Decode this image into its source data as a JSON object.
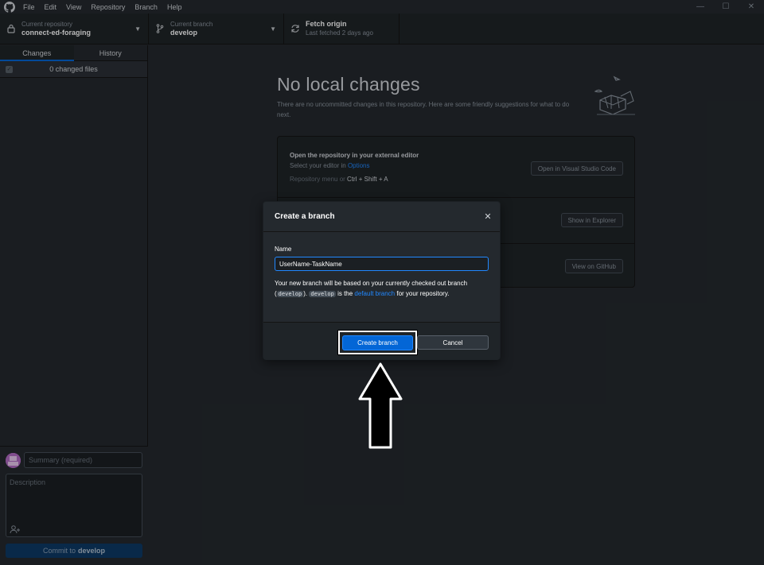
{
  "menu": [
    "File",
    "Edit",
    "View",
    "Repository",
    "Branch",
    "Help"
  ],
  "window_controls": {
    "minimize": "—",
    "maximize": "☐",
    "close": "✕"
  },
  "toolbar": {
    "repo_sub": "Current repository",
    "repo_name": "connect-ed-foraging",
    "branch_sub": "Current branch",
    "branch_name": "develop",
    "fetch_title": "Fetch origin",
    "fetch_sub": "Last fetched 2 days ago"
  },
  "sidebar": {
    "tabs": [
      "Changes",
      "History"
    ],
    "changed_files": "0 changed files",
    "summary_placeholder": "Summary (required)",
    "description_placeholder": "Description",
    "commit_prefix": "Commit to",
    "commit_branch": "develop"
  },
  "main": {
    "title": "No local changes",
    "subtitle": "There are no uncommitted changes in this repository. Here are some friendly suggestions for what to do next.",
    "suggestions": [
      {
        "title": "Open the repository in your external editor",
        "desc_prefix": "Select your editor in",
        "desc_link": "Options",
        "hint_prefix": "Repository menu or",
        "hint_keys": "Ctrl + Shift + A",
        "button": "Open in Visual Studio Code"
      },
      {
        "button": "Show in Explorer"
      },
      {
        "button": "View on GitHub"
      }
    ]
  },
  "dialog": {
    "title": "Create a branch",
    "close": "✕",
    "name_label": "Name",
    "name_value": "UserName-TaskName",
    "note_1": "Your new branch will be based on your currently checked out branch (",
    "note_code_1": "develop",
    "note_2": ").",
    "note_code_2": "develop",
    "note_3": "is the",
    "note_link": "default branch",
    "note_4": "for your repository.",
    "create_button": "Create branch",
    "cancel_button": "Cancel"
  },
  "colors": {
    "accent": "#0366d6",
    "link": "#2188ff",
    "background": "#24292e"
  }
}
